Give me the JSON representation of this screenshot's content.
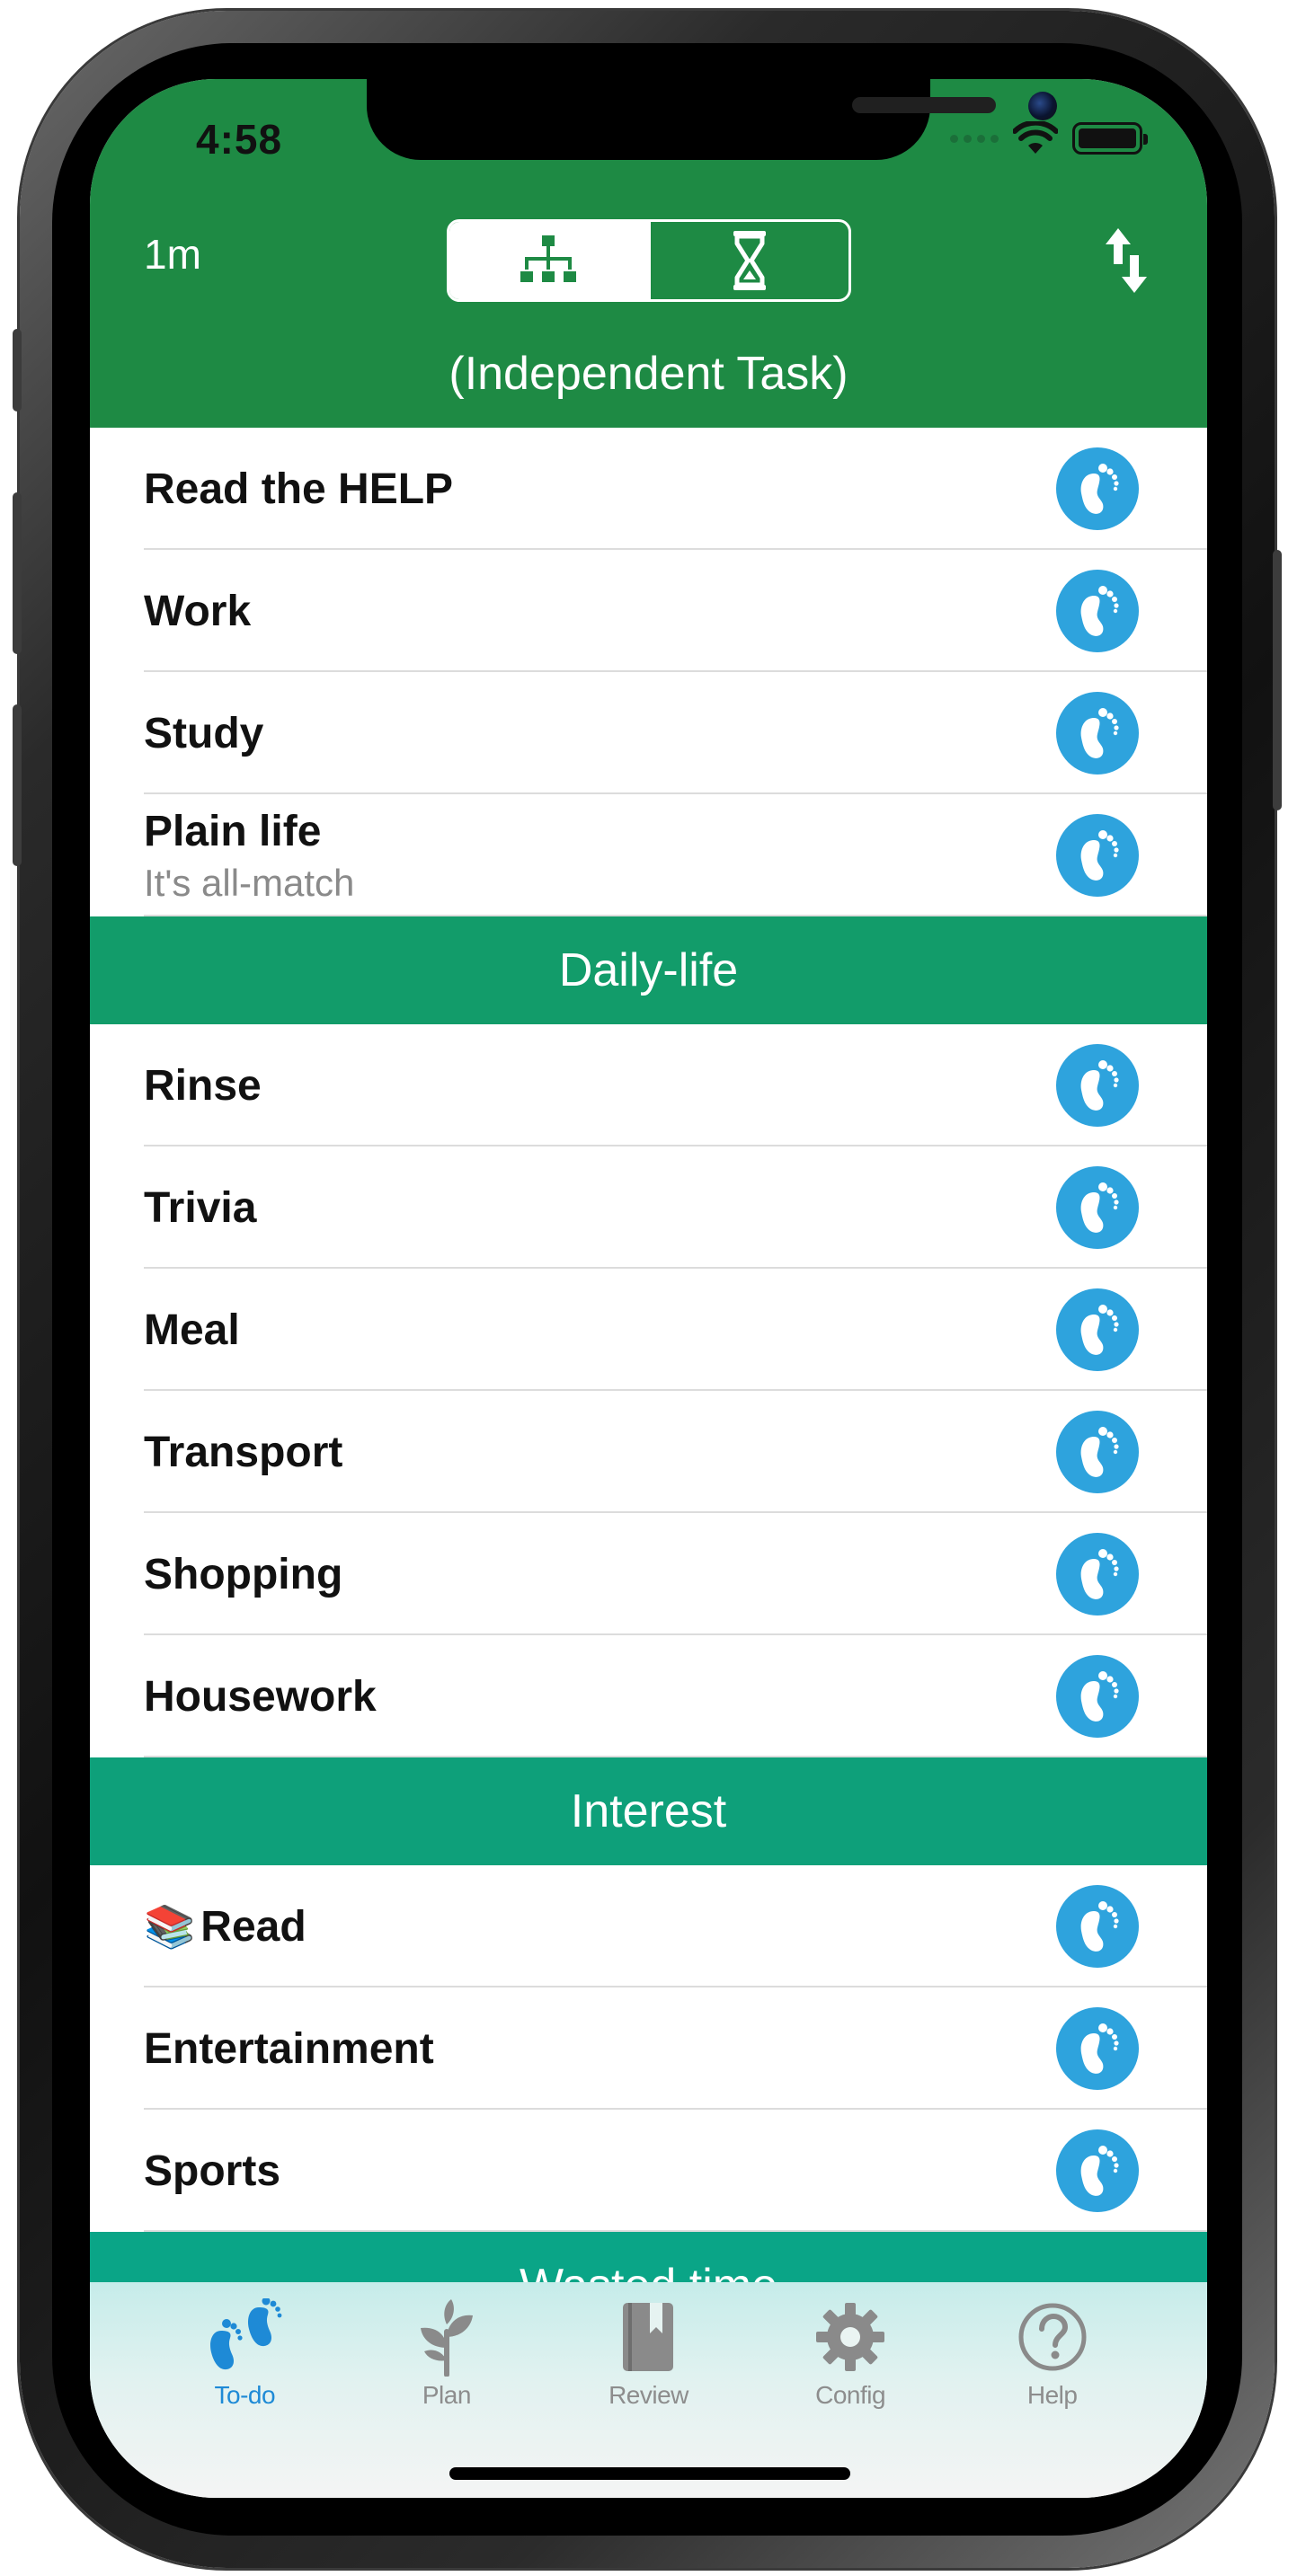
{
  "status_bar": {
    "time": "4:58"
  },
  "header": {
    "timer": "1m"
  },
  "sections": [
    {
      "title": "(Independent Task)",
      "color": "#1e8a44",
      "rows": [
        {
          "label": "Read the HELP",
          "sub": ""
        },
        {
          "label": "Work",
          "sub": ""
        },
        {
          "label": "Study",
          "sub": ""
        },
        {
          "label": "Plain life",
          "sub": "It's all-match"
        }
      ]
    },
    {
      "title": "Daily-life",
      "color": "#129c6a",
      "rows": [
        {
          "label": "Rinse",
          "sub": ""
        },
        {
          "label": "Trivia",
          "sub": ""
        },
        {
          "label": "Meal",
          "sub": ""
        },
        {
          "label": "Transport",
          "sub": ""
        },
        {
          "label": "Shopping",
          "sub": ""
        },
        {
          "label": "Housework",
          "sub": ""
        }
      ]
    },
    {
      "title": "Interest",
      "color": "#0ea07a",
      "rows": [
        {
          "label": "Read",
          "sub": "",
          "emoji": "📚"
        },
        {
          "label": "Entertainment",
          "sub": ""
        },
        {
          "label": "Sports",
          "sub": ""
        }
      ]
    },
    {
      "title": "Wasted time",
      "color": "#0aa587",
      "rows": []
    }
  ],
  "tabs": [
    {
      "label": "To-do",
      "icon": "footprints-icon",
      "active": true
    },
    {
      "label": "Plan",
      "icon": "sprout-icon",
      "active": false
    },
    {
      "label": "Review",
      "icon": "book-icon",
      "active": false
    },
    {
      "label": "Config",
      "icon": "gear-icon",
      "active": false
    },
    {
      "label": "Help",
      "icon": "question-icon",
      "active": false
    }
  ],
  "colors": {
    "header": "#1e8a44",
    "start_button": "#2ea3dd",
    "tab_active": "#1e8ad6"
  }
}
